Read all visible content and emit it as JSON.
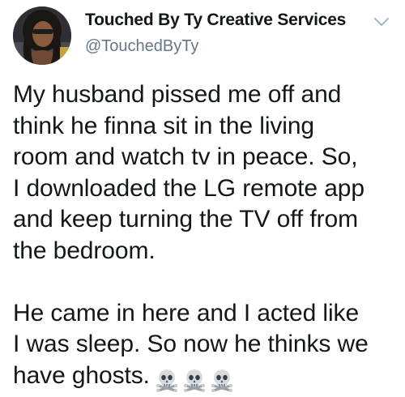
{
  "tweet": {
    "display_name": "Touched By Ty Creative Services",
    "handle": "@TouchedByTy",
    "paragraphs": [
      "My husband pissed me off and\nthink he finna sit in the living\nroom and watch tv in peace. So,\nI downloaded the LG remote app\nand keep turning the TV off from\nthe bedroom.",
      "He came in here and I acted like\nI was sleep. So now he thinks we\nhave ghosts."
    ],
    "emoji": [
      "skull-and-crossbones",
      "skull-and-crossbones",
      "skull-and-crossbones"
    ],
    "icons": {
      "more": "chevron-down-icon",
      "avatar": "profile-photo"
    }
  },
  "colors": {
    "text": "#14171a",
    "secondary_text": "#657786",
    "chevron": "#aab8c2",
    "background": "#ffffff"
  }
}
